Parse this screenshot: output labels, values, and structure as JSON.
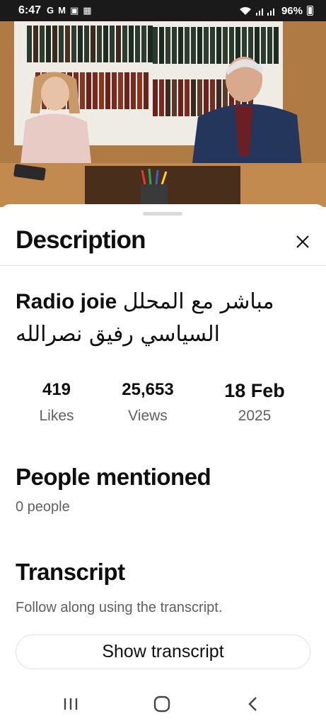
{
  "status_bar": {
    "time": "6:47",
    "notification_icons": [
      "G",
      "M",
      "▣",
      "▦"
    ],
    "battery": "96%"
  },
  "sheet": {
    "title": "Description",
    "close_icon": "close-icon"
  },
  "video": {
    "title_latin": "Radio joie",
    "title_arabic": "مباشر مع المحلل السياسي رفيق نصرالله"
  },
  "stats": {
    "likes_value": "419",
    "likes_label": "Likes",
    "views_value": "25,653",
    "views_label": "Views",
    "date_value": "18 Feb",
    "date_year": "2025"
  },
  "people": {
    "title": "People mentioned",
    "count": "0 people"
  },
  "transcript": {
    "title": "Transcript",
    "subtitle": "Follow along using the transcript.",
    "button_label": "Show transcript"
  },
  "nav": {
    "recents_icon": "recents-icon",
    "home_icon": "home-icon",
    "back_icon": "back-icon"
  }
}
